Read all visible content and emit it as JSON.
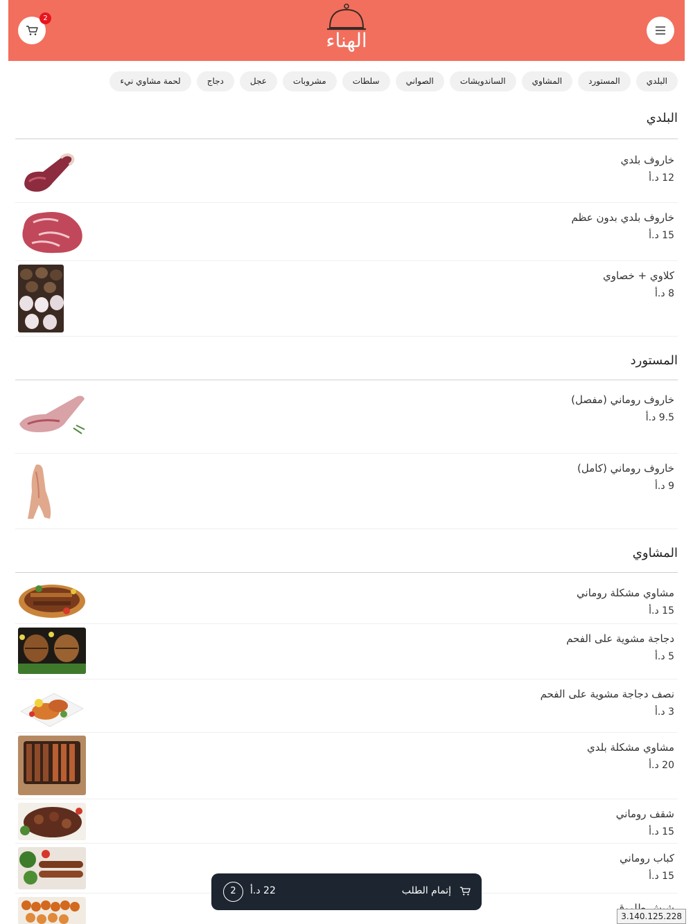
{
  "header": {
    "logo_text": "الهناء",
    "cart_count": "2",
    "colors": {
      "brand": "#f26f5d",
      "badge": "#e8141e"
    }
  },
  "categories": [
    "البلدي",
    "المستورد",
    "المشاوي",
    "الساندويشات",
    "الصواني",
    "سلطات",
    "مشروبات",
    "عجل",
    "دجاج",
    "لحمة مشاوي نيء"
  ],
  "sections": [
    {
      "title": "البلدي",
      "items": [
        {
          "name": "خاروف بلدي",
          "price": "12 د.أ"
        },
        {
          "name": "خاروف بلدي بدون عظم",
          "price": "15 د.أ"
        },
        {
          "name": "كلاوي + خصاوي",
          "price": "8 د.أ"
        }
      ]
    },
    {
      "title": "المستورد",
      "items": [
        {
          "name": "خاروف روماني (مفصل)",
          "price": "9.5 د.أ"
        },
        {
          "name": "خاروف روماني (كامل)",
          "price": "9 د.أ"
        }
      ]
    },
    {
      "title": "المشاوي",
      "items": [
        {
          "name": "مشاوي مشكلة روماني",
          "price": "15 د.أ"
        },
        {
          "name": "دجاجة مشوية على الفحم",
          "price": "5 د.أ"
        },
        {
          "name": "نصف دجاجة مشوية على الفحم",
          "price": "3 د.أ"
        },
        {
          "name": "مشاوي مشكلة بلدي",
          "price": "20 د.أ"
        },
        {
          "name": "شقف روماني",
          "price": "15 د.أ"
        },
        {
          "name": "كباب روماني",
          "price": "15 د.أ"
        },
        {
          "name": "شيش طاووق",
          "price": ""
        }
      ]
    }
  ],
  "checkout": {
    "label": "إتمام الطلب",
    "total": "22 د.أ",
    "count": "2"
  },
  "ip_address": "3.140.125.228"
}
